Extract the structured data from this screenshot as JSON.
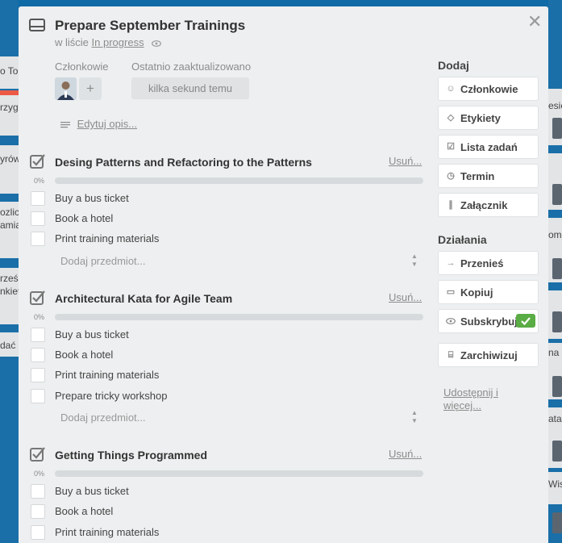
{
  "card": {
    "title": "Prepare September Trainings",
    "in_list_prefix": "w liście",
    "list_name": "In progress",
    "members_label": "Członkowie",
    "updated_label": "Ostatnio zaaktualizowano",
    "updated_value": "kilka sekund temu",
    "add_member_label": "+",
    "edit_description": "Edytuj opis..."
  },
  "checklists": [
    {
      "title": "Desing Patterns and Refactoring to the Patterns",
      "delete_label": "Usuń...",
      "progress_label": "0%",
      "progress": 0,
      "items": [
        {
          "label": "Buy a bus ticket"
        },
        {
          "label": "Book a hotel"
        },
        {
          "label": "Print training materials"
        }
      ],
      "add_placeholder": "Dodaj przedmiot..."
    },
    {
      "title": "Architectural Kata for Agile Team",
      "delete_label": "Usuń...",
      "progress_label": "0%",
      "progress": 0,
      "items": [
        {
          "label": "Buy a bus ticket"
        },
        {
          "label": "Book a hotel"
        },
        {
          "label": "Print training materials"
        },
        {
          "label": "Prepare tricky workshop"
        }
      ],
      "add_placeholder": "Dodaj przedmiot..."
    },
    {
      "title": "Getting Things Programmed",
      "delete_label": "Usuń...",
      "progress_label": "0%",
      "progress": 0,
      "items": [
        {
          "label": "Buy a bus ticket"
        },
        {
          "label": "Book a hotel"
        },
        {
          "label": "Print training materials"
        }
      ]
    }
  ],
  "sidebar": {
    "add_heading": "Dodaj",
    "add_buttons": [
      {
        "label": "Członkowie",
        "icon": "person-icon"
      },
      {
        "label": "Etykiety",
        "icon": "tag-icon"
      },
      {
        "label": "Lista zadań",
        "icon": "checklist-icon"
      },
      {
        "label": "Termin",
        "icon": "clock-icon"
      },
      {
        "label": "Załącznik",
        "icon": "paperclip-icon"
      }
    ],
    "actions_heading": "Działania",
    "action_buttons": [
      {
        "label": "Przenieś",
        "icon": "arrow-right-icon"
      },
      {
        "label": "Kopiuj",
        "icon": "card-icon"
      },
      {
        "label": "Subskrybuj",
        "icon": "eye-icon",
        "checked": true
      },
      {
        "label": "Zarchiwizuj",
        "icon": "archive-icon"
      }
    ],
    "share_label": "Udostępnij i więcej..."
  },
  "background": {
    "left_fragments": [
      "o To",
      "rzyg",
      "yrów",
      "ozlic",
      "amia",
      "rześ",
      "nkiet",
      "dać"
    ],
    "right_fragments": [
      "esie",
      "om",
      "na",
      "ata",
      "Wise"
    ]
  },
  "colors": {
    "board_bg": "#0f6aa6",
    "dialog_bg": "#edeff0",
    "subscribe_check": "#5aac44"
  }
}
